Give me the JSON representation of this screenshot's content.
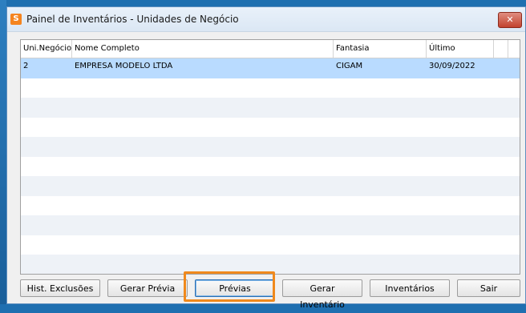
{
  "window": {
    "title": "Painel de Inventários - Unidades de Negócio",
    "app_icon_glyph": "S",
    "close_label": "✕"
  },
  "grid": {
    "columns": [
      "Uni.Negócio",
      "Nome Completo",
      "Fantasia",
      "Último Inventário"
    ],
    "rows": [
      {
        "uni": "2",
        "nome": "EMPRESA MODELO LTDA",
        "fantasia": "CIGAM",
        "ultimo": "30/09/2022",
        "selected": true
      }
    ]
  },
  "buttons": {
    "hist": "Hist. Exclusões",
    "gerar_previa": "Gerar Prévia",
    "previas": "Prévias",
    "gerar_inventario": "Gerar Inventário",
    "inventarios": "Inventários",
    "sair": "Sair"
  },
  "colors": {
    "selected_row": "#b9dbff",
    "highlight": "#f0891c"
  }
}
